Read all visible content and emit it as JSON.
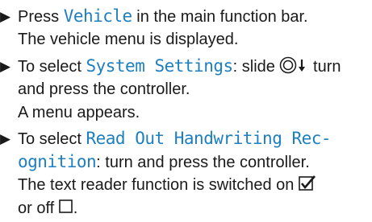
{
  "steps": [
    {
      "bullet": "▶",
      "lines": [
        {
          "prefix": "Press ",
          "term": "Vehicle",
          "suffix": " in the main function bar."
        },
        {
          "text": "The vehicle menu is displayed."
        }
      ]
    },
    {
      "bullet": "▶",
      "lines": [
        {
          "prefix": "To select ",
          "term": "System Settings",
          "suffix": ": slide ",
          "icon": "controller-slide-down-icon",
          "after_icon": " turn"
        },
        {
          "text": "and press the controller."
        },
        {
          "text": "A menu appears."
        }
      ]
    },
    {
      "bullet": "▶",
      "lines": [
        {
          "prefix": "To select ",
          "term": "Read Out Handwriting Rec-"
        },
        {
          "term": "ognition",
          "suffix": ": turn and press the controller."
        },
        {
          "text": "The text reader function is switched on ",
          "icon": "checkbox-checked-icon"
        },
        {
          "text": "or off ",
          "icon": "checkbox-empty-icon",
          "after_icon": "."
        }
      ]
    }
  ]
}
